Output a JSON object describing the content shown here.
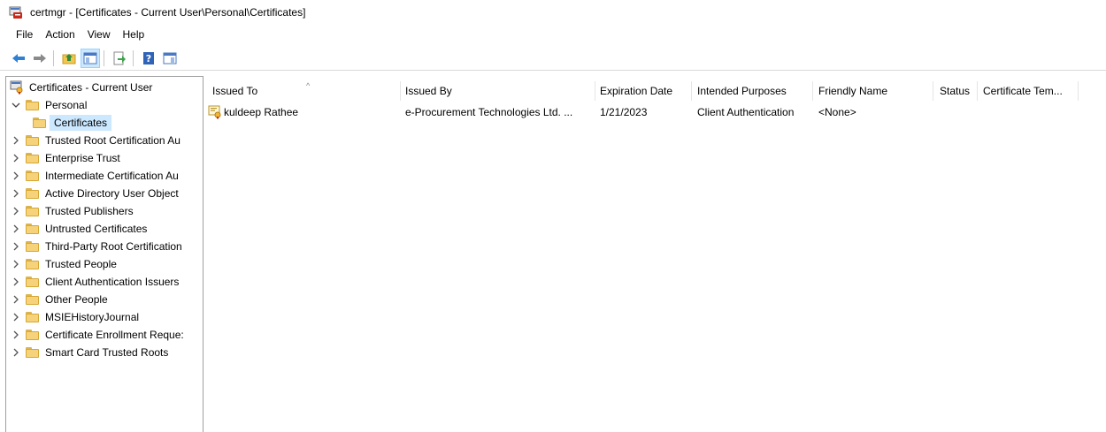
{
  "window": {
    "title": "certmgr - [Certificates - Current User\\Personal\\Certificates]"
  },
  "menu": [
    "File",
    "Action",
    "View",
    "Help"
  ],
  "toolbar": {
    "buttons": [
      "back-icon",
      "forward-icon",
      "up-folder-icon",
      "show-hide-console-tree-icon",
      "export-list-icon",
      "help-icon",
      "show-hide-action-pane-icon"
    ]
  },
  "tree": {
    "root": "Certificates - Current User",
    "personal": "Personal",
    "certificates": "Certificates",
    "items": [
      "Trusted Root Certification Au",
      "Enterprise Trust",
      "Intermediate Certification Au",
      "Active Directory User Object",
      "Trusted Publishers",
      "Untrusted Certificates",
      "Third-Party Root Certification",
      "Trusted People",
      "Client Authentication Issuers",
      "Other People",
      "MSIEHistoryJournal",
      "Certificate Enrollment Reque:",
      "Smart Card Trusted Roots"
    ]
  },
  "list": {
    "columns": [
      "Issued To",
      "Issued By",
      "Expiration Date",
      "Intended Purposes",
      "Friendly Name",
      "Status",
      "Certificate Tem..."
    ],
    "rows": [
      [
        "kuldeep Rathee",
        "e-Procurement Technologies Ltd. ...",
        "1/21/2023",
        "Client Authentication",
        "<None>",
        "",
        ""
      ]
    ]
  },
  "colors": {
    "selection": "#cce8ff",
    "folder": "#f6d37a",
    "border": "#a0a0a0"
  }
}
